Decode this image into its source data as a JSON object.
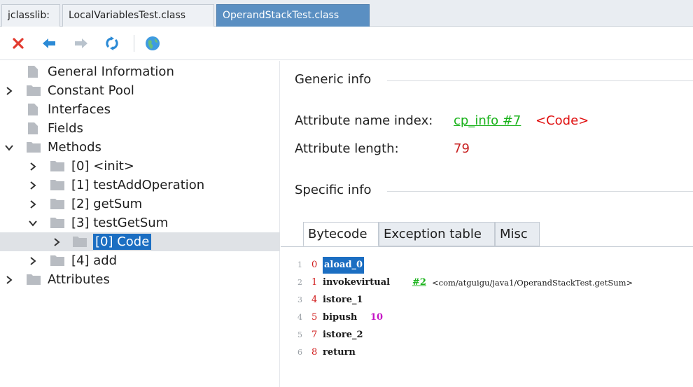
{
  "tabs": {
    "app": "jclasslib:",
    "items": [
      "LocalVariablesTest.class",
      "OperandStackTest.class"
    ],
    "active_index": 1
  },
  "toolbar": {
    "icons": [
      "close-icon",
      "back-arrow-icon",
      "forward-arrow-icon",
      "reload-icon",
      "web-icon"
    ]
  },
  "tree": {
    "items": [
      {
        "label": "General Information",
        "icon": "file-icon"
      },
      {
        "label": "Constant Pool",
        "icon": "folder-icon"
      },
      {
        "label": "Interfaces",
        "icon": "file-icon"
      },
      {
        "label": "Fields",
        "icon": "file-icon"
      },
      {
        "label": "Methods",
        "icon": "folder-icon"
      },
      {
        "label": "[0] <init>",
        "icon": "folder-icon"
      },
      {
        "label": "[1] testAddOperation",
        "icon": "folder-icon"
      },
      {
        "label": "[2] getSum",
        "icon": "folder-icon"
      },
      {
        "label": "[3] testGetSum",
        "icon": "folder-icon"
      },
      {
        "label": "[0] Code",
        "icon": "folder-icon"
      },
      {
        "label": "[4] add",
        "icon": "folder-icon"
      },
      {
        "label": "Attributes",
        "icon": "folder-icon"
      }
    ]
  },
  "generic_info": {
    "title": "Generic info",
    "name_index_label": "Attribute name index:",
    "name_index_link": "cp_info #7",
    "name_index_ref": "<Code>",
    "length_label": "Attribute length:",
    "length_value": "79"
  },
  "specific_info": {
    "title": "Specific info",
    "tabs": [
      "Bytecode",
      "Exception table",
      "Misc"
    ]
  },
  "bytecode": [
    {
      "line": "1",
      "offset": "0",
      "op": "aload_0"
    },
    {
      "line": "2",
      "offset": "1",
      "op": "invokevirtual",
      "ref": "#2",
      "comment": "<com/atguigu/java1/OperandStackTest.getSum>"
    },
    {
      "line": "3",
      "offset": "4",
      "op": "istore_1"
    },
    {
      "line": "4",
      "offset": "5",
      "op": "bipush",
      "arg": "10"
    },
    {
      "line": "5",
      "offset": "7",
      "op": "istore_2"
    },
    {
      "line": "6",
      "offset": "8",
      "op": "return"
    }
  ],
  "colors": {
    "active_tab": "#5a8fc2",
    "selection": "#1b6ec2",
    "link": "#19b21a",
    "value_red": "#c82020",
    "number_magenta": "#c514c5"
  }
}
